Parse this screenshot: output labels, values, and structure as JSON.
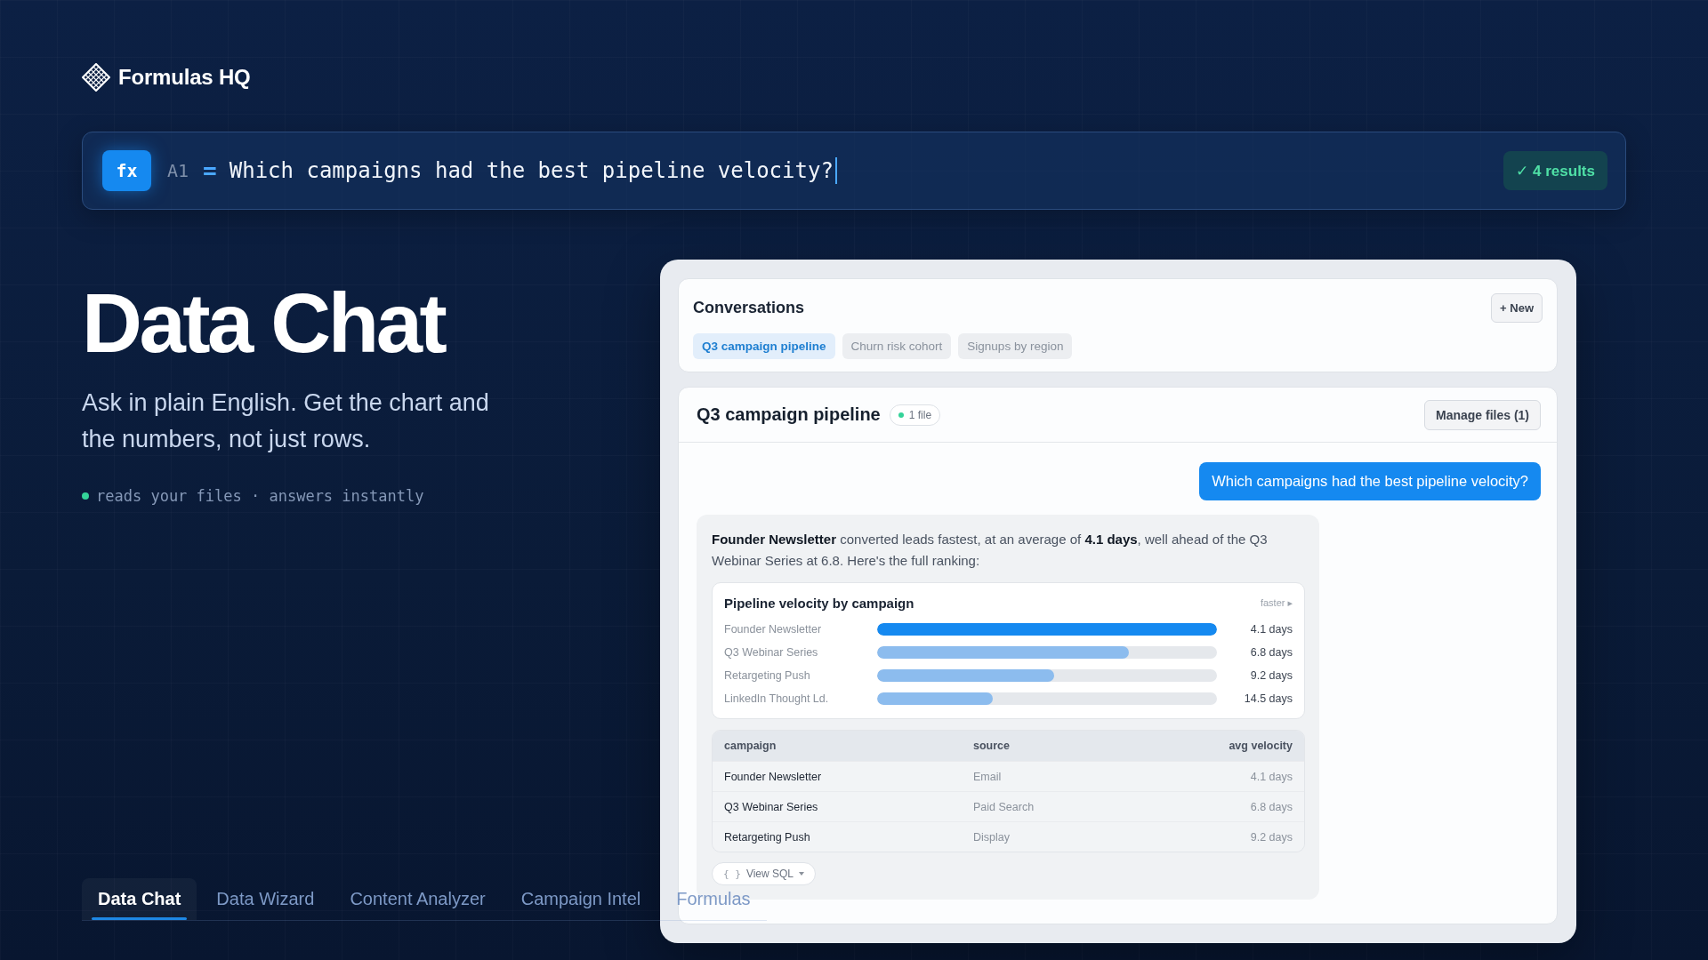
{
  "brand": {
    "name": "Formulas HQ"
  },
  "formula_bar": {
    "button": "fx",
    "cell": "A1",
    "operator": "=",
    "query": "Which campaigns had the best pipeline velocity?",
    "result_badge": "✓ 4 results"
  },
  "hero": {
    "title": "Data Chat",
    "subtitle": "Ask in plain English. Get the chart and the numbers, not just rows.",
    "status": "reads your files · answers instantly"
  },
  "bottom_tabs": [
    {
      "label": "Data Chat",
      "selected": true
    },
    {
      "label": "Data Wizard",
      "selected": false
    },
    {
      "label": "Content Analyzer",
      "selected": false
    },
    {
      "label": "Campaign Intel",
      "selected": false
    },
    {
      "label": "Formulas",
      "selected": false
    }
  ],
  "panel": {
    "conversations": {
      "title": "Conversations",
      "new_button": "+ New",
      "items": [
        {
          "label": "Q3 campaign pipeline",
          "selected": true
        },
        {
          "label": "Churn risk cohort",
          "selected": false
        },
        {
          "label": "Signups by region",
          "selected": false
        }
      ]
    },
    "chat": {
      "title": "Q3 campaign pipeline",
      "file_badge": "1 file",
      "manage_button": "Manage files (1)",
      "messages": [
        {
          "kind": "user",
          "text": "Which campaigns had the best pipeline velocity?"
        },
        {
          "kind": "assistant",
          "text": "**Founder Newsletter** converted leads fastest, at an average of **4.1 days**, well ahead of the Q3 Webinar Series at 6.8. Here's the full ranking:",
          "chart": {
            "title": "Pipeline velocity by campaign",
            "hint": "faster ▸",
            "bars": [
              {
                "label": "Founder Newsletter",
                "level": 1.0,
                "reading": "4.1 days",
                "highlighted": true
              },
              {
                "label": "Q3 Webinar Series",
                "level": 0.74,
                "reading": "6.8 days",
                "highlighted": false
              },
              {
                "label": "Retargeting Push",
                "level": 0.52,
                "reading": "9.2 days",
                "highlighted": false
              },
              {
                "label": "LinkedIn Thought Ld.",
                "level": 0.34,
                "reading": "14.5 days",
                "highlighted": false
              }
            ]
          },
          "table": {
            "columns": [
              "campaign",
              "source",
              "avg velocity"
            ],
            "rows": [
              [
                "Founder Newsletter",
                "Email",
                "4.1 days"
              ],
              [
                "Q3 Webinar Series",
                "Paid Search",
                "6.8 days"
              ],
              [
                "Retargeting Push",
                "Display",
                "9.2 days"
              ]
            ]
          },
          "sql_button": {
            "icon": "{ }",
            "label": "View SQL"
          }
        }
      ]
    }
  }
}
